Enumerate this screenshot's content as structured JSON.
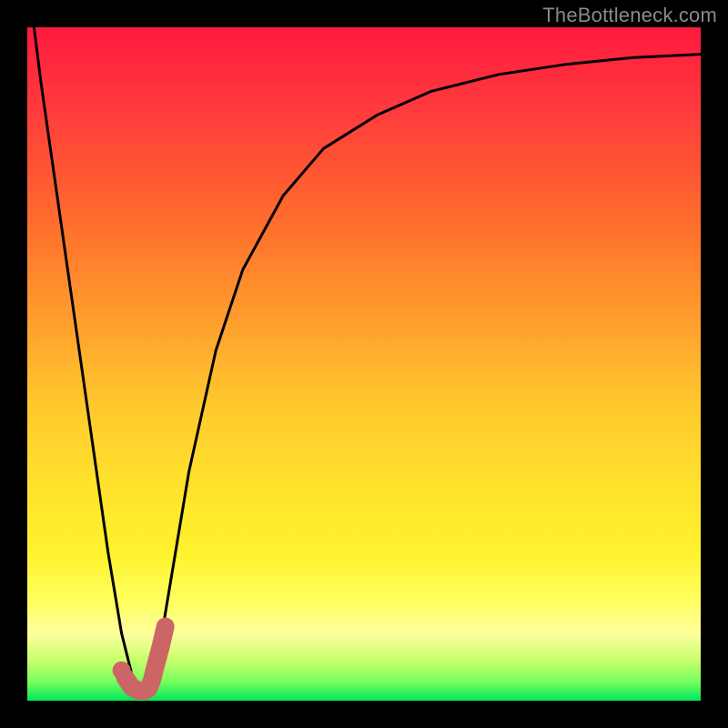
{
  "watermark": "TheBottleneck.com",
  "chart_data": {
    "type": "line",
    "title": "",
    "xlabel": "",
    "ylabel": "",
    "xlim": [
      0,
      100
    ],
    "ylim": [
      0,
      100
    ],
    "series": [
      {
        "name": "bottleneck-curve",
        "x": [
          1,
          2,
          4,
          6,
          8,
          10,
          12,
          14,
          15.5,
          16.5,
          17.5,
          19,
          20,
          22,
          24,
          28,
          32,
          38,
          44,
          52,
          60,
          70,
          80,
          90,
          100
        ],
        "values": [
          100,
          92,
          78,
          64,
          50,
          36,
          22,
          10,
          4,
          1.5,
          1.5,
          4,
          10,
          22,
          34,
          52,
          64,
          75,
          82,
          87,
          90.5,
          93,
          94.5,
          95.5,
          96
        ]
      }
    ],
    "marker": {
      "name": "highlight-segment",
      "x": [
        14.5,
        15.5,
        16.5,
        17,
        17.5,
        18,
        18.5,
        19,
        19.8,
        20.5
      ],
      "values": [
        3.5,
        2,
        1.5,
        1.5,
        1.5,
        1.8,
        3,
        5,
        8,
        11
      ],
      "color": "#cc6666"
    },
    "dot": {
      "name": "highlight-dot",
      "x": 14.0,
      "value": 4.5,
      "color": "#cc6666"
    },
    "colors": {
      "curve": "#000000",
      "background_top": "#ff1a3d",
      "background_bottom": "#00e85d"
    }
  }
}
